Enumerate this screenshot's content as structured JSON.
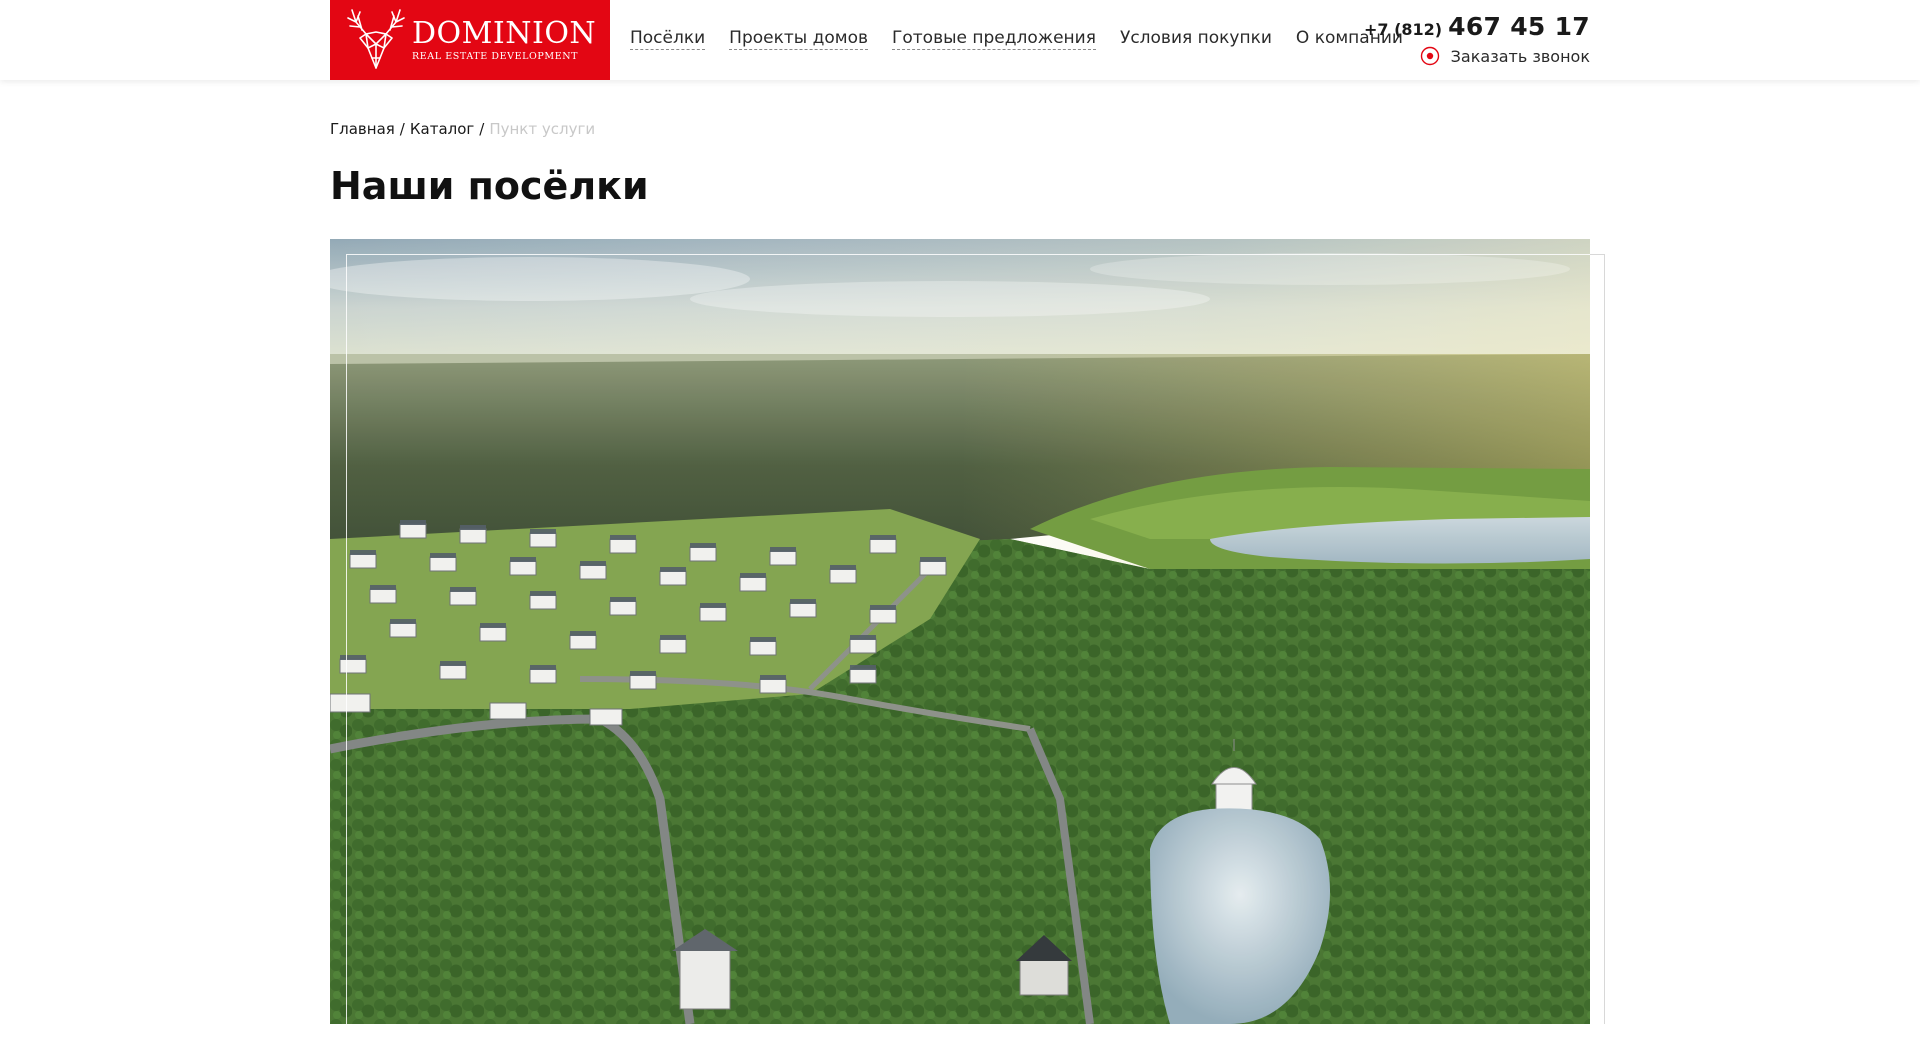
{
  "brand": {
    "name": "DOMINION",
    "tagline": "REAL ESTATE DEVELOPMENT",
    "logo_color": "#e30613"
  },
  "nav": {
    "items": [
      {
        "label": "Посёлки",
        "icon": null
      },
      {
        "label": "Проекты домов",
        "icon": null
      },
      {
        "label": "Готовые предложения",
        "icon": null
      },
      {
        "label": "Условия покупки",
        "icon": null
      },
      {
        "label": "О компании",
        "icon": null
      }
    ]
  },
  "contact": {
    "phone_code": "+7 (812)",
    "phone_number": "467 45 17",
    "callback_label": "Заказать звонок",
    "callback_icon": "phone-target-icon"
  },
  "breadcrumb": {
    "home": "Главная",
    "catalog": "Каталог",
    "current": "Пункт услуги",
    "separator": "/"
  },
  "page": {
    "title": "Наши посёлки"
  },
  "hero": {
    "image": "aerial-village-landscape"
  },
  "colors": {
    "accent": "#e30613",
    "text": "#1a1a1a",
    "muted": "#c8c8c8"
  }
}
